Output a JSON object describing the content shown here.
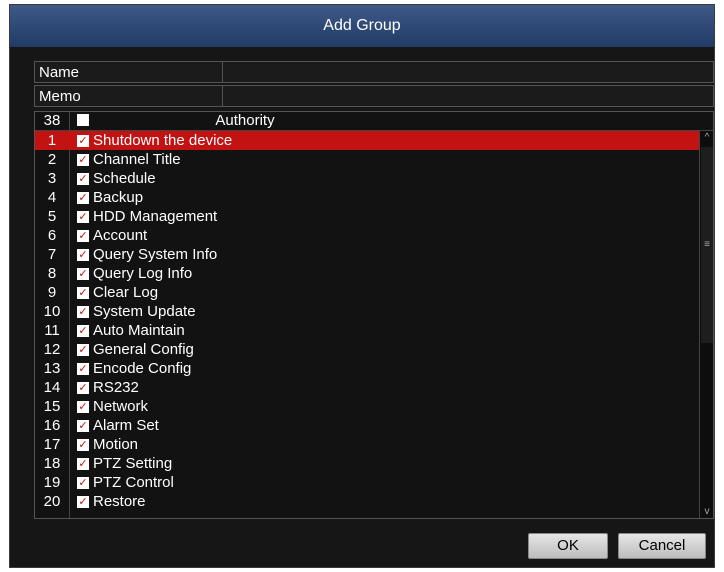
{
  "dialog": {
    "title": "Add Group"
  },
  "fields": {
    "name_label": "Name",
    "name_value": "",
    "memo_label": "Memo",
    "memo_value": ""
  },
  "table": {
    "count": "38",
    "header": "Authority",
    "rows": [
      {
        "num": "1",
        "label": "Shutdown the device",
        "checked": true,
        "selected": true
      },
      {
        "num": "2",
        "label": "Channel Title",
        "checked": true
      },
      {
        "num": "3",
        "label": "Schedule",
        "checked": true
      },
      {
        "num": "4",
        "label": "Backup",
        "checked": true
      },
      {
        "num": "5",
        "label": "HDD Management",
        "checked": true
      },
      {
        "num": "6",
        "label": "Account",
        "checked": true
      },
      {
        "num": "7",
        "label": "Query System Info",
        "checked": true
      },
      {
        "num": "8",
        "label": "Query Log Info",
        "checked": true
      },
      {
        "num": "9",
        "label": "Clear Log",
        "checked": true
      },
      {
        "num": "10",
        "label": "System Update",
        "checked": true
      },
      {
        "num": "11",
        "label": "Auto Maintain",
        "checked": true
      },
      {
        "num": "12",
        "label": "General Config",
        "checked": true
      },
      {
        "num": "13",
        "label": "Encode Config",
        "checked": true
      },
      {
        "num": "14",
        "label": "RS232",
        "checked": true
      },
      {
        "num": "15",
        "label": "Network",
        "checked": true
      },
      {
        "num": "16",
        "label": "Alarm Set",
        "checked": true
      },
      {
        "num": "17",
        "label": "Motion",
        "checked": true
      },
      {
        "num": "18",
        "label": "PTZ Setting",
        "checked": true
      },
      {
        "num": "19",
        "label": "PTZ Control",
        "checked": true
      },
      {
        "num": "20",
        "label": "Restore",
        "checked": true
      }
    ]
  },
  "buttons": {
    "ok": "OK",
    "cancel": "Cancel"
  },
  "icons": {
    "scroll_up": "chevron-up-icon",
    "scroll_down": "chevron-down-icon",
    "scroll_grip": "grip-icon"
  },
  "colors": {
    "selected_row": "#c21212",
    "title_bar": "#2e4a7a",
    "background": "#161616"
  }
}
